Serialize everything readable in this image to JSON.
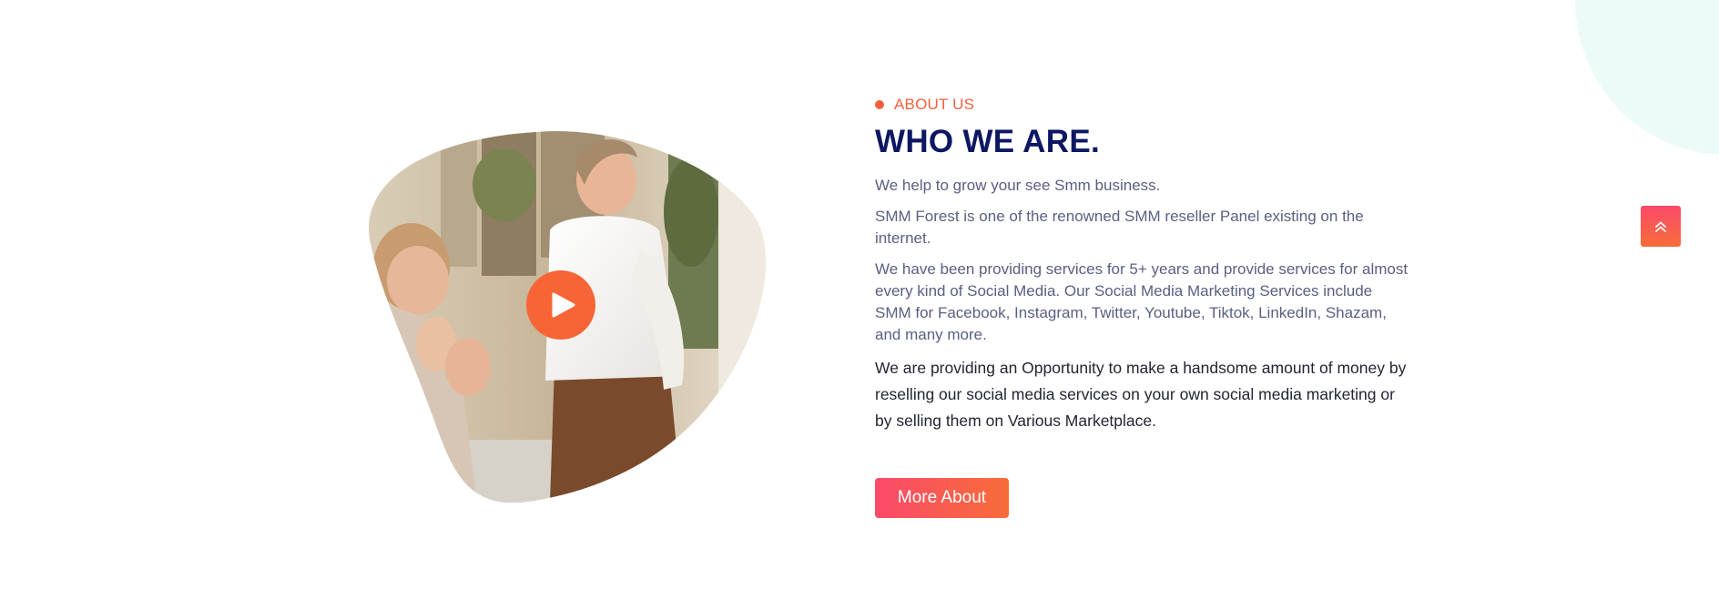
{
  "about": {
    "eyebrow": "ABOUT US",
    "title": "WHO WE ARE.",
    "paragraphs": [
      "We help to grow your see Smm business.",
      "SMM Forest is one of the renowned SMM reseller Panel existing on the internet.",
      "We have been providing services for 5+ years and provide services for almost every kind of Social Media. Our Social Media Marketing Services include SMM for Facebook, Instagram, Twitter, Youtube, Tiktok, LinkedIn, Shazam, and many more.",
      "We are providing an Opportunity to make a handsome amount of money by reselling our social media services on your own social media marketing or by selling them on Various Marketplace."
    ],
    "button_label": "More About"
  },
  "media": {
    "image": "office-team-meeting-photo",
    "play_icon": "play-icon"
  },
  "scroll_top": {
    "icon": "double-chevron-up-icon"
  },
  "colors": {
    "accent": "#f6603d",
    "title": "#0e1762",
    "body_text": "#5a5f83",
    "dark_text": "#232532",
    "button_gradient_start": "#fb4a6a",
    "button_gradient_end": "#f76c38",
    "corner_blob": "#ecfbf7"
  }
}
